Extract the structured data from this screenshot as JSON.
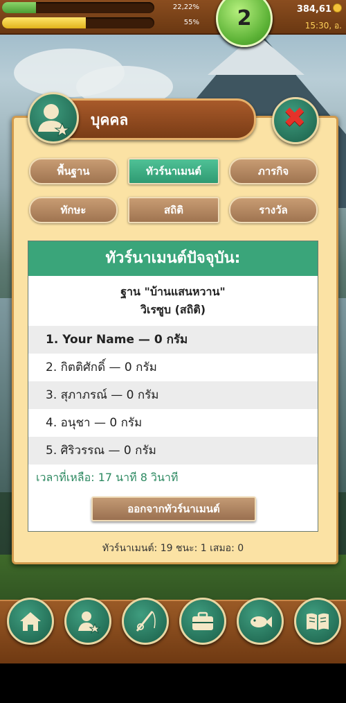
{
  "hud": {
    "xp_percent_label": "22,22%",
    "xp_fraction": 0.2222,
    "energy_percent_label": "55%",
    "energy_fraction": 0.55,
    "level": "2",
    "money": "384,61",
    "clock": "15:30, อ."
  },
  "dialog": {
    "title": "บุคคล",
    "close_icon": "close-icon",
    "tabs": [
      "พื้นฐาน",
      "ทัวร์นาเมนต์",
      "ภารกิจ",
      "ทักษะ",
      "สถิติ",
      "รางวัล"
    ],
    "active_tab": "ทัวร์นาเมนต์"
  },
  "tournament": {
    "header": "ทัวร์นาเมนต์ปัจจุบัน:",
    "venue_line1": "ฐาน \"บ้านแสนหวาน\"",
    "venue_line2": "วิเรซูบ (สถิติ)",
    "rows": [
      "1. Your Name — 0 กรัม",
      "2. กิตติศักดิ์ — 0 กรัม",
      "3. สุภาภรณ์ — 0 กรัม",
      "4. อนุชา — 0 กรัม",
      "5. ศิริวรรณ — 0 กรัม"
    ],
    "time_left": "เวลาที่เหลือ: 17 นาที 8 วินาที",
    "leave_button": "ออกจากทัวร์นาเมนต์",
    "stats": "ทัวร์นาเมนต์: 19  ชนะ: 1  เสมอ: 0"
  },
  "nav": {
    "items": [
      "home-icon",
      "profile-icon",
      "fishing-rod-icon",
      "briefcase-icon",
      "fish-icon",
      "book-icon"
    ]
  },
  "colors": {
    "accent_green": "#3aa57a",
    "panel_bg": "#fbe2a4",
    "wood": "#7a3c16"
  }
}
